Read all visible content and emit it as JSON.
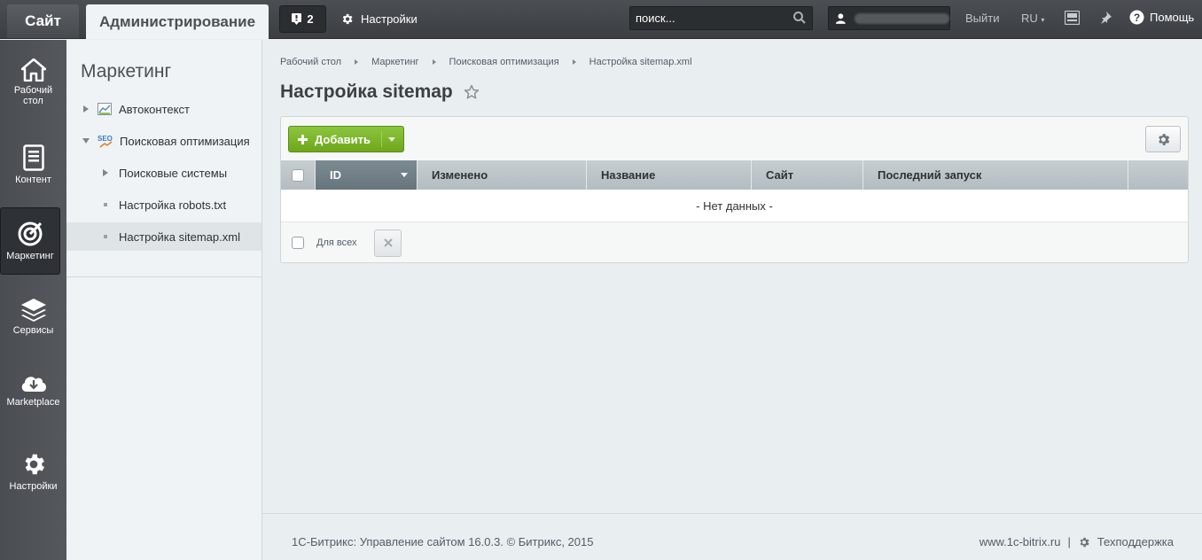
{
  "topbar": {
    "site_tab": "Сайт",
    "admin_tab": "Администрирование",
    "notifications_count": "2",
    "settings_label": "Настройки",
    "search_placeholder": "поиск...",
    "logout_label": "Выйти",
    "language": "RU",
    "help_label": "Помощь"
  },
  "leftnav": {
    "items": [
      {
        "label": "Рабочий стол",
        "icon": "home-icon"
      },
      {
        "label": "Контент",
        "icon": "document-icon"
      },
      {
        "label": "Маркетинг",
        "icon": "target-icon"
      },
      {
        "label": "Сервисы",
        "icon": "layers-icon"
      },
      {
        "label": "Marketplace",
        "icon": "cloud-download-icon"
      },
      {
        "label": "Настройки",
        "icon": "gear-icon"
      }
    ]
  },
  "secnav": {
    "title": "Маркетинг",
    "items": [
      {
        "label": "Автоконтекст"
      },
      {
        "label": "Поисковая оптимизация"
      },
      {
        "label": "Поисковые системы"
      },
      {
        "label": "Настройка robots.txt"
      },
      {
        "label": "Настройка sitemap.xml"
      }
    ]
  },
  "breadcrumb": [
    "Рабочий стол",
    "Маркетинг",
    "Поисковая оптимизация",
    "Настройка sitemap.xml"
  ],
  "page": {
    "title": "Настройка sitemap"
  },
  "grid": {
    "add_button": "Добавить",
    "columns": [
      "ID",
      "Изменено",
      "Название",
      "Сайт",
      "Последний запуск"
    ],
    "empty_text": "- Нет данных -",
    "for_all_label": "Для всех"
  },
  "footer": {
    "copyright": "1С-Битрикс: Управление сайтом 16.0.3. © Битрикс, 2015",
    "site_link": "www.1c-bitrix.ru",
    "support_label": "Техподдержка"
  }
}
